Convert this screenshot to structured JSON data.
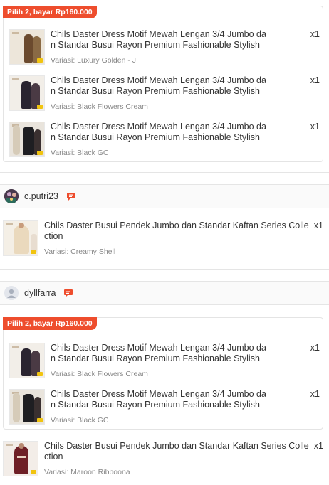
{
  "bundles": [
    {
      "badge": "Pilih 2, bayar Rp160.000",
      "items": [
        {
          "title": "Chils Daster Dress Motif Mewah Lengan 3/4 Jumbo dan Standar Busui Rayon Premium Fashionable Stylish",
          "qty": "x1",
          "variant": "Variasi: Luxury Golden - J"
        },
        {
          "title": "Chils Daster Dress Motif Mewah Lengan 3/4 Jumbo dan Standar Busui Rayon Premium Fashionable Stylish",
          "qty": "x1",
          "variant": "Variasi: Black Flowers Cream"
        },
        {
          "title": "Chils Daster Dress Motif Mewah Lengan 3/4 Jumbo dan Standar Busui Rayon Premium Fashionable Stylish",
          "qty": "x1",
          "variant": "Variasi: Black GC"
        }
      ]
    },
    {
      "badge": "Pilih 2, bayar Rp160.000",
      "items": [
        {
          "title": "Chils Daster Dress Motif Mewah Lengan 3/4 Jumbo dan Standar Busui Rayon Premium Fashionable Stylish",
          "qty": "x1",
          "variant": "Variasi: Black Flowers Cream"
        },
        {
          "title": "Chils Daster Dress Motif Mewah Lengan 3/4 Jumbo dan Standar Busui Rayon Premium Fashionable Stylish",
          "qty": "x1",
          "variant": "Variasi: Black GC"
        }
      ]
    }
  ],
  "sellers": [
    {
      "name": "c.putri23",
      "avatar_icon": "user-photo-avatar",
      "chat_icon": "chat-icon"
    },
    {
      "name": "dyllfarra",
      "avatar_icon": "default-user-avatar",
      "chat_icon": "chat-icon"
    }
  ],
  "single_items": [
    {
      "title": "Chils Daster Busui Pendek Jumbo dan Standar Kaftan Series Collection",
      "qty": "x1",
      "variant": "Variasi: Creamy Shell"
    },
    {
      "title": "Chils Daster Busui Pendek Jumbo dan Standar Kaftan Series Collection",
      "qty": "x1",
      "variant": "Variasi: Maroon Ribboona"
    }
  ],
  "colors": {
    "accent": "#ee4d2d",
    "muted_text": "#888888",
    "body_text": "#333333"
  }
}
